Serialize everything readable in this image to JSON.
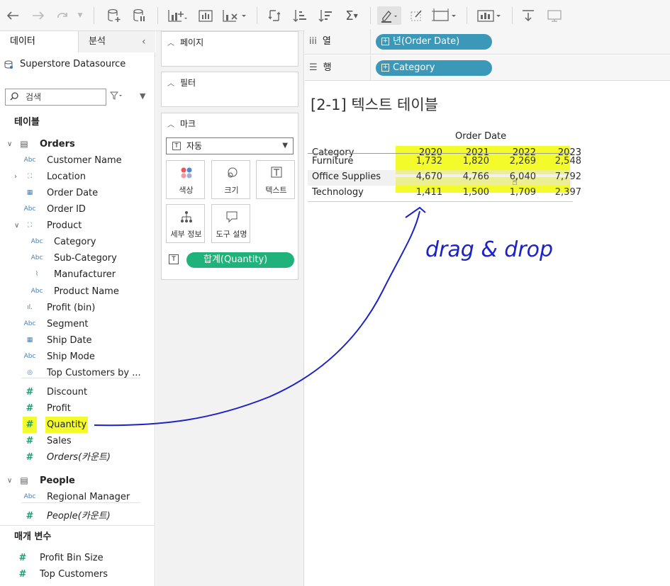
{
  "left_panel": {
    "tab_data": "데이터",
    "tab_analysis": "분석",
    "datasource": "Superstore Datasource",
    "search_placeholder": "검색",
    "tables_header": "테이블",
    "params_header": "매개 변수"
  },
  "fields": [
    {
      "type": "table",
      "label": "Orders"
    },
    {
      "type": "Abc",
      "label": "Customer Name"
    },
    {
      "type": "hier",
      "label": "Location"
    },
    {
      "type": "date",
      "label": "Order Date"
    },
    {
      "type": "Abc",
      "label": "Order ID"
    },
    {
      "type": "hier",
      "label": "Product"
    },
    {
      "type": "Abc",
      "label": "Category"
    },
    {
      "type": "Abc",
      "label": "Sub-Category"
    },
    {
      "type": "clip",
      "label": "Manufacturer"
    },
    {
      "type": "Abc",
      "label": "Product Name"
    },
    {
      "type": "bin",
      "label": "Profit (bin)"
    },
    {
      "type": "Abc",
      "label": "Segment"
    },
    {
      "type": "date",
      "label": "Ship Date"
    },
    {
      "type": "Abc",
      "label": "Ship Mode"
    },
    {
      "type": "set",
      "label": "Top Customers by ..."
    },
    {
      "type": "#",
      "label": "Discount"
    },
    {
      "type": "#",
      "label": "Profit"
    },
    {
      "type": "#",
      "label": "Quantity"
    },
    {
      "type": "#",
      "label": "Sales"
    },
    {
      "type": "#",
      "label": "Orders(카운트)"
    },
    {
      "type": "table",
      "label": "People"
    },
    {
      "type": "Abc",
      "label": "Regional Manager"
    },
    {
      "type": "#",
      "label": "People(카운트)"
    },
    {
      "type": "#",
      "label": "Profit Bin Size"
    },
    {
      "type": "#",
      "label": "Top Customers"
    }
  ],
  "middle": {
    "pages": "페이지",
    "filters": "필터",
    "marks": "마크",
    "mark_type": "자동",
    "color": "색상",
    "size": "크기",
    "text": "텍스트",
    "detail": "세부 정보",
    "tooltip": "도구 설명",
    "pill": "합계(Quantity)"
  },
  "shelves": {
    "columns_label": "열",
    "columns_pill": "년(Order Date)",
    "rows_label": "행",
    "rows_pill": "Category"
  },
  "view": {
    "title": "[2-1] 텍스트 테이블",
    "col_header": "Order Date",
    "row_header": "Category",
    "years": [
      "2020",
      "2021",
      "2022",
      "2023"
    ],
    "rows": [
      {
        "name": "Furniture",
        "values": [
          "1,732",
          "1,820",
          "2,269",
          "2,548"
        ]
      },
      {
        "name": "Office Supplies",
        "values": [
          "4,670",
          "4,766",
          "6,040",
          "7,792"
        ]
      },
      {
        "name": "Technology",
        "values": [
          "1,411",
          "1,500",
          "1,709",
          "2,397"
        ]
      }
    ]
  },
  "annotation": {
    "text": "drag & drop",
    "highlight_color": "#f4fb2a",
    "ink_color": "#1b22c9"
  }
}
